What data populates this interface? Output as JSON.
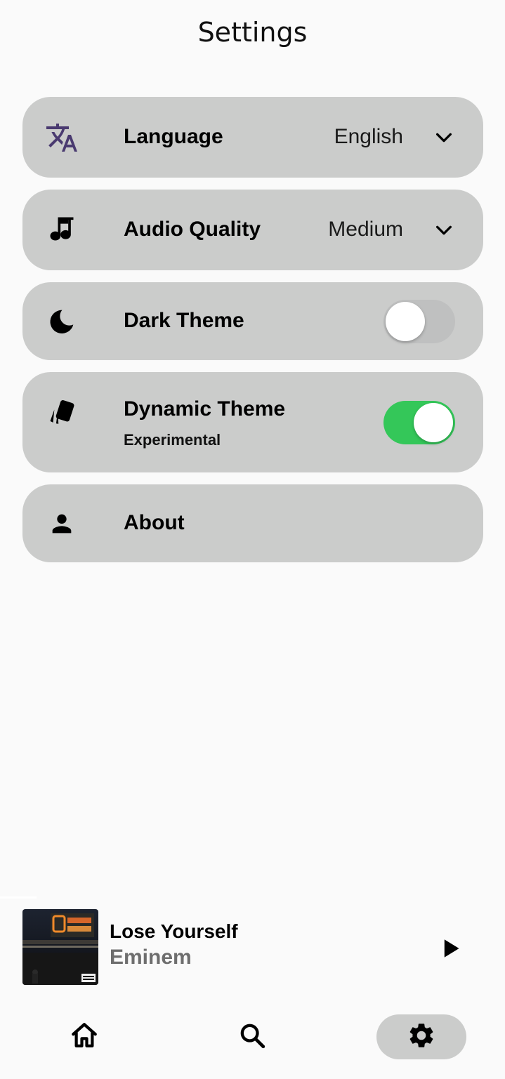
{
  "header": {
    "title": "Settings"
  },
  "settings": [
    {
      "key": "language",
      "icon": "translate-icon",
      "label": "Language",
      "value": "English",
      "control": "dropdown"
    },
    {
      "key": "audio_quality",
      "icon": "music-note-icon",
      "label": "Audio Quality",
      "value": "Medium",
      "control": "dropdown"
    },
    {
      "key": "dark_theme",
      "icon": "moon-icon",
      "label": "Dark Theme",
      "control": "toggle",
      "enabled": false
    },
    {
      "key": "dynamic_theme",
      "icon": "cards-icon",
      "label": "Dynamic Theme",
      "sublabel": "Experimental",
      "control": "toggle",
      "enabled": true
    },
    {
      "key": "about",
      "icon": "person-icon",
      "label": "About",
      "control": "none"
    }
  ],
  "player": {
    "title": "Lose Yourself",
    "artist": "Eminem",
    "album_art_icon": "album-art-image",
    "play_icon": "play-icon"
  },
  "nav": {
    "items": [
      {
        "name": "home",
        "icon": "home-icon",
        "active": false
      },
      {
        "name": "search",
        "icon": "search-icon",
        "active": false
      },
      {
        "name": "settings",
        "icon": "gear-icon",
        "active": true
      }
    ]
  },
  "colors": {
    "background": "#fafafa",
    "card": "#cbcccb",
    "toggle_on": "#34c759",
    "toggle_off": "#bfc0c0",
    "translate_icon": "#4a3a70",
    "artist_text": "#6e6e6e"
  }
}
